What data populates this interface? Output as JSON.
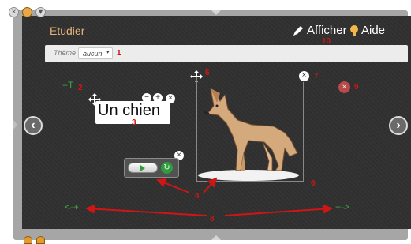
{
  "window": {
    "controls": [
      "close-icon",
      "resize-icon",
      "chevron-down-icon"
    ],
    "title": "Etudier"
  },
  "toolbar": {
    "display_label": "Afficher",
    "help_label": "Aide",
    "display_icon": "pencil-icon",
    "help_icon": "lightbulb-icon"
  },
  "theme": {
    "label": "Thème",
    "selected": "aucun"
  },
  "canvas": {
    "add_text_label": "+T",
    "text_item": "Un chien",
    "image_icon": "dog-image",
    "left_spacing_label": "<-+",
    "right_spacing_label": "+->"
  },
  "annotations": {
    "n1": "1",
    "n2": "2",
    "n3": "3",
    "n4": "4",
    "n5": "5",
    "n6": "6",
    "n7": "7",
    "n8": "8",
    "n9": "9",
    "n10": "10"
  },
  "colors": {
    "accent_title": "#e8b27a",
    "annotation_red": "#d01515",
    "green": "#3ea33e",
    "board_bg": "#2f2f2f"
  }
}
